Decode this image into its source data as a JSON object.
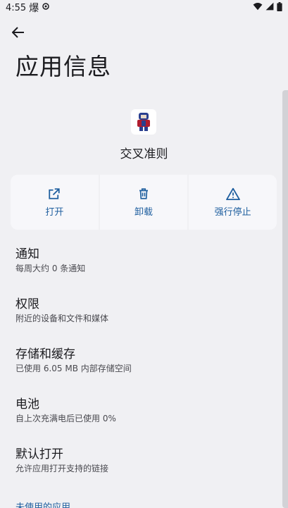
{
  "status_bar": {
    "time": "4:55",
    "notif_glyph": "爆"
  },
  "header": {
    "title": "应用信息"
  },
  "app": {
    "name": "交叉准则"
  },
  "actions": [
    {
      "label": "打开",
      "icon": "open-external-icon"
    },
    {
      "label": "卸载",
      "icon": "trash-icon"
    },
    {
      "label": "强行停止",
      "icon": "warning-icon"
    }
  ],
  "items": [
    {
      "title": "通知",
      "subtitle": "每周大约 0 条通知"
    },
    {
      "title": "权限",
      "subtitle": "附近的设备和文件和媒体"
    },
    {
      "title": "存储和缓存",
      "subtitle": "已使用 6.05 MB 内部存储空间"
    },
    {
      "title": "电池",
      "subtitle": "自上次充满电后已使用 0%"
    },
    {
      "title": "默认打开",
      "subtitle": "允许应用打开支持的链接"
    }
  ],
  "section_link": "未使用的应用",
  "colors": {
    "accent": "#1f5f9f",
    "background": "#f0f0f3"
  }
}
